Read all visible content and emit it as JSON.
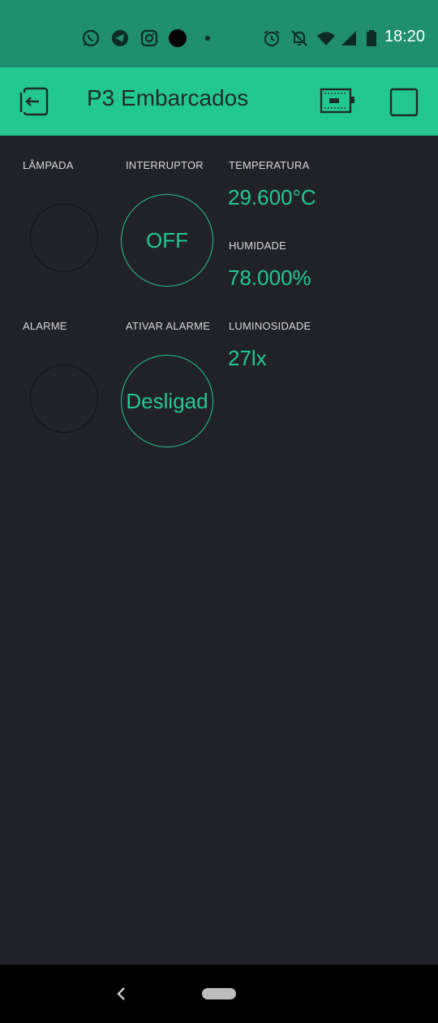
{
  "status_bar": {
    "time": "18:20",
    "icons": [
      "whatsapp-icon",
      "telegram-icon",
      "instagram-icon",
      "dark-circle-icon",
      "dot-icon",
      "alarm-icon",
      "mute-bell-icon",
      "wifi-icon",
      "signal-icon",
      "battery-icon"
    ]
  },
  "app_bar": {
    "title": "P3 Embarcados",
    "icons": [
      "exit-icon",
      "device-board-icon",
      "stop-square-icon"
    ]
  },
  "widgets": {
    "lampada": {
      "label": "LÂMPADA"
    },
    "interruptor": {
      "label": "INTERRUPTOR",
      "state": "OFF"
    },
    "temperatura": {
      "label": "TEMPERATURA",
      "value": "29.600°C"
    },
    "humidade": {
      "label": "HUMIDADE",
      "value": "78.000%"
    },
    "alarme": {
      "label": "ALARME"
    },
    "ativar_alarme": {
      "label": "ATIVAR ALARME",
      "state": "Desligad"
    },
    "luminosidade": {
      "label": "LUMINOSIDADE",
      "value": "27lx"
    }
  },
  "colors": {
    "accent": "#23c890",
    "status_bar": "#1f8f6d",
    "background": "#212227"
  },
  "nav_bar": {
    "icons": [
      "back-icon",
      "home-pill-icon"
    ]
  }
}
